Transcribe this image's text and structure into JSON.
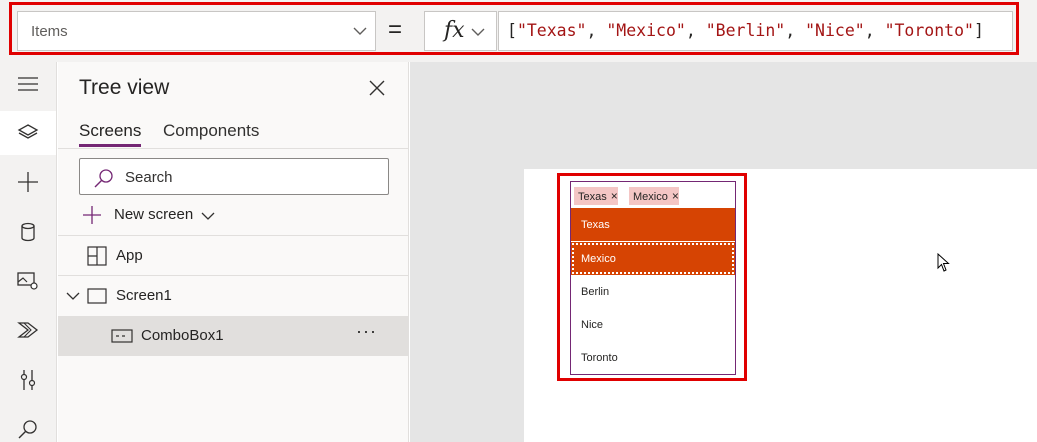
{
  "formula_bar": {
    "property": "Items",
    "equals": "=",
    "fx": "fx",
    "formula_tokens": [
      {
        "t": "[",
        "k": "punct"
      },
      {
        "t": "\"Texas\"",
        "k": "str"
      },
      {
        "t": ", ",
        "k": "punct"
      },
      {
        "t": "\"Mexico\"",
        "k": "str"
      },
      {
        "t": ", ",
        "k": "punct"
      },
      {
        "t": "\"Berlin\"",
        "k": "str"
      },
      {
        "t": ", ",
        "k": "punct"
      },
      {
        "t": "\"Nice\"",
        "k": "str"
      },
      {
        "t": ", ",
        "k": "punct"
      },
      {
        "t": "\"Toronto\"",
        "k": "str"
      },
      {
        "t": "]",
        "k": "punct"
      }
    ]
  },
  "rail": {
    "icons": [
      "hamburger-icon",
      "layers-icon",
      "plus-icon",
      "database-icon",
      "media-icon",
      "power-automate-icon",
      "tools-icon",
      "search-icon"
    ],
    "active": "layers-icon"
  },
  "tree_view": {
    "title": "Tree view",
    "tabs": [
      {
        "label": "Screens",
        "active": true
      },
      {
        "label": "Components",
        "active": false
      }
    ],
    "search_placeholder": "Search",
    "new_screen_label": "New screen",
    "nodes": {
      "app": "App",
      "screen": "Screen1",
      "combobox": "ComboBox1"
    },
    "more_label": "···"
  },
  "combobox": {
    "selected_chips": [
      "Texas",
      "Mexico"
    ],
    "chip_remove": "×",
    "options": [
      {
        "label": "Texas",
        "selected": true,
        "focused": false
      },
      {
        "label": "Mexico",
        "selected": true,
        "focused": true
      },
      {
        "label": "Berlin",
        "selected": false,
        "focused": false
      },
      {
        "label": "Nice",
        "selected": false,
        "focused": false
      },
      {
        "label": "Toronto",
        "selected": false,
        "focused": false
      }
    ]
  },
  "colors": {
    "accent": "#742774",
    "selection": "#d64403",
    "chip": "#f4c6c5",
    "highlight_outline": "#e00000",
    "string_token": "#a31515"
  }
}
